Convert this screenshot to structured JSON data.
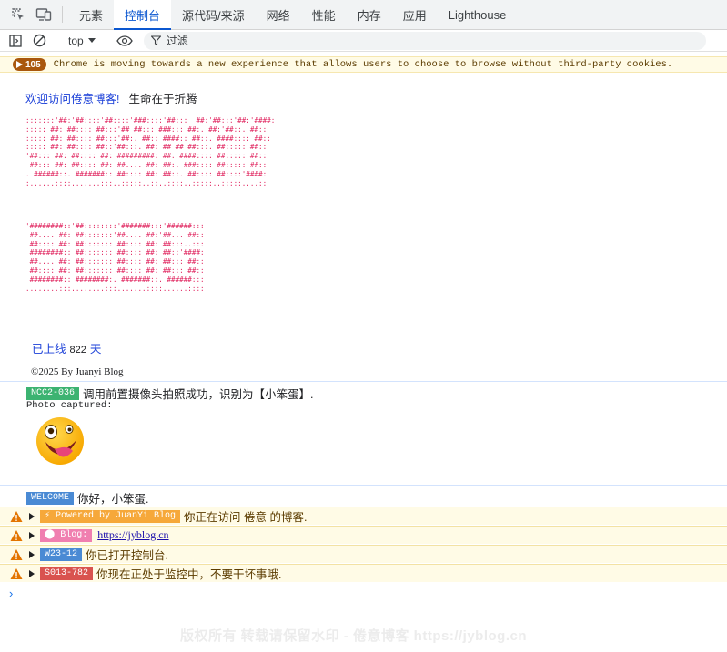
{
  "tabs": [
    {
      "label": "元素"
    },
    {
      "label": "控制台"
    },
    {
      "label": "源代码/来源"
    },
    {
      "label": "网络"
    },
    {
      "label": "性能"
    },
    {
      "label": "内存"
    },
    {
      "label": "应用"
    },
    {
      "label": "Lighthouse"
    }
  ],
  "active_tab": "控制台",
  "toolbar": {
    "context": "top",
    "filter_placeholder": "过滤"
  },
  "issues": {
    "count": "105",
    "message": "Chrome is moving towards a new experience that allows users to choose to browse without third-party cookies."
  },
  "console": {
    "welcome_blue": "欢迎访问倦意博客!",
    "welcome_black": "生命在于折腾",
    "ascii_art_1": ":::::::'##:'##::::'##::::'###::::'##:::  ##:'##:::'##:'####:\n::::: ##: ##:::: ##:::'## ##::: ###::: ##:. ##:'##::. ##::\n::::: ##: ##:::: ##:::'##:. ##:: ####:: ##::. ####:::: ##::\n::::: ##: ##:::: ##::'##:::. ##: ## ## ##:::. ##::::: ##::\n'##::: ##: ##:::: ##: #########: ##. ####:::: ##::::: ##::\n ##::: ##: ##:::: ##: ##.... ##: ##:. ###:::: ##::::: ##::\n. ######::. #######:: ##:::: ##: ##::. ##:::: ##::::'####:\n:......::::.......:::..:::::..::..::::..:::::..:::::....::",
    "ascii_art_2": "'########::'##::::::::'#######:::'######:::\n ##.... ##: ##:::::::'##.... ##:'##... ##::\n ##:::: ##: ##::::::: ##:::: ##: ##:::..:::\n ########:: ##::::::: ##:::: ##: ##::'####:\n ##.... ##: ##::::::: ##:::: ##: ##::: ##::\n ##:::: ##: ##::::::: ##:::: ##: ##::: ##::\n ########:: ########:. #######::. ######:::\n........:::........:::.......::::......::::",
    "online_prefix": "已上线",
    "online_days": "822",
    "online_suffix": "天",
    "copyright": "©2025 By Juanyi Blog",
    "ncc_tag": "NCC2-036",
    "ncc_text": "调用前置摄像头拍照成功，识别为【小笨蛋】.",
    "photo_caption": "Photo captured:",
    "welcome_tag": "WELCOME",
    "welcome_text": "你好，小笨蛋.",
    "warnings": [
      {
        "tag": "⚡ Powered by JuanYi Blog",
        "text": "你正在访问 倦意 的博客.",
        "tag_color": "#f6a83a"
      },
      {
        "tag": "⬤ Blog:",
        "text": "https://jyblog.cn",
        "tag_color": "#f07fb0",
        "is_link": true
      },
      {
        "tag": "W23-12",
        "text": "你已打开控制台.",
        "tag_color": "#4a8ad4"
      },
      {
        "tag": "S013-782",
        "text": "你现在正处于监控中，不要干坏事哦.",
        "tag_color": "#d9534f"
      }
    ]
  },
  "watermark": "版权所有 转载请保留水印 - 倦意博客 https://jyblog.cn",
  "colors": {
    "accent": "#0b57d0",
    "ascii": "#e0245e",
    "ncc_tag": "#3cb371",
    "welcome_tag": "#4a8ad4",
    "warning_bg": "#fffbe6",
    "issue_badge": "#a9570d"
  }
}
